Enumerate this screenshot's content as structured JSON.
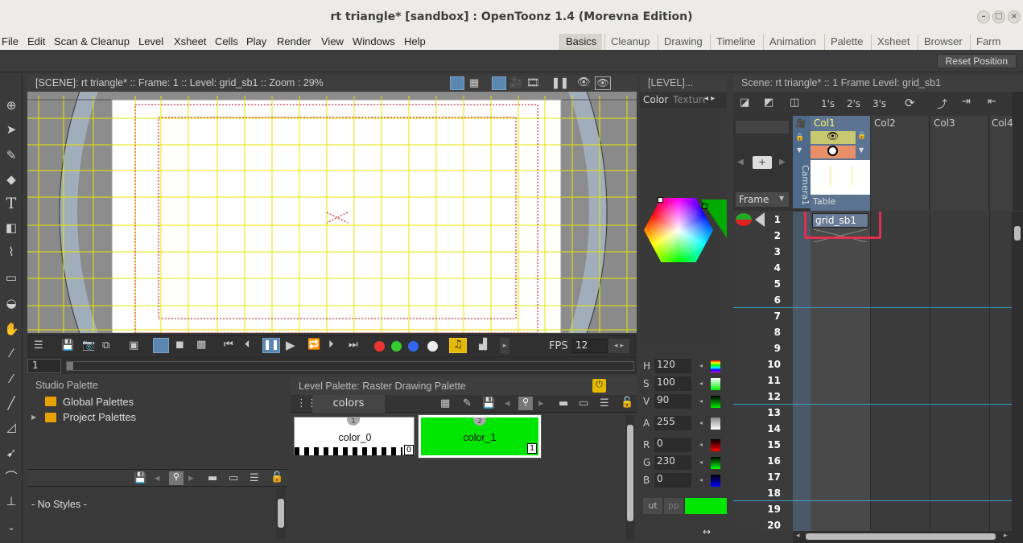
{
  "window": {
    "title": "rt triangle* [sandbox] : OpenToonz 1.4 (Morevna Edition)"
  },
  "menu": [
    "File",
    "Edit",
    "Scan & Cleanup",
    "Level",
    "Xsheet",
    "Cells",
    "Play",
    "Render",
    "View",
    "Windows",
    "Help"
  ],
  "rooms": [
    "Basics",
    "Cleanup",
    "Drawing",
    "Timeline",
    "Animation",
    "Palette",
    "Xsheet",
    "Browser",
    "Farm"
  ],
  "active_room": "Basics",
  "toolbar": {
    "reset_label": "Reset Position"
  },
  "viewer": {
    "header": "[SCENE]: rt triangle*  ::  Frame: 1  ::  Level: grid_sb1  ::  Zoom : 29%",
    "fps_label": "FPS",
    "fps_value": "12",
    "frame_value": "1"
  },
  "style_editor": {
    "header": "[LEVEL]...",
    "tab_color": "Color",
    "tab_texture": "Texture",
    "h_label": "H",
    "h": "120",
    "s_label": "S",
    "s": "100",
    "v_label": "V",
    "v": "90",
    "a_label": "A",
    "a": "255",
    "r_label": "R",
    "r": "0",
    "g_label": "G",
    "g": "230",
    "b_label": "B",
    "b": "0",
    "btn_auto": "ut",
    "btn_apply": "pp",
    "current_color": "#00e600"
  },
  "studio_palette": {
    "title": "Studio Palette",
    "items": [
      "Global Palettes",
      "Project Palettes"
    ]
  },
  "style_list": {
    "empty": "- No Styles -"
  },
  "level_palette": {
    "title": "Level Palette: Raster Drawing Palette",
    "tab": "colors",
    "chips": [
      {
        "name": "color_0",
        "index": "0",
        "num": "1"
      },
      {
        "name": "color_1",
        "index": "1",
        "num": "2",
        "color": "#00e600"
      }
    ]
  },
  "xsheet": {
    "header": "Scene: rt triangle*  ::  1 Frame  Level: grid_sb1",
    "step_buttons": [
      "1's",
      "2's",
      "3's"
    ],
    "columns": [
      "Col1",
      "Col2",
      "Col3",
      "Col4"
    ],
    "camera_label": "Camera1",
    "table_label": "Table",
    "frame_label": "Frame",
    "cell": "grid_sb1",
    "frames": [
      "1",
      "2",
      "3",
      "4",
      "5",
      "6",
      "7",
      "8",
      "9",
      "10",
      "11",
      "12",
      "13",
      "14",
      "15",
      "16",
      "17",
      "18",
      "19",
      "20"
    ]
  }
}
